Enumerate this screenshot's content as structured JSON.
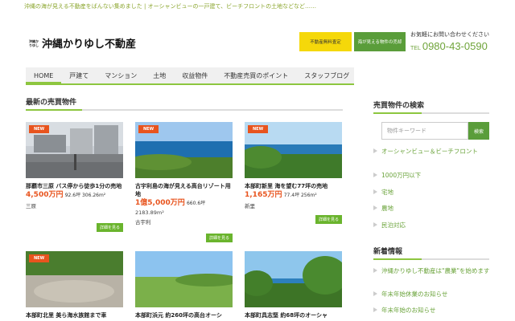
{
  "tagline": "沖縄の海が見える不動産をばんない集めました | オーシャンビューの一戸建て、ビーチフロントの土地などなど……",
  "logo": {
    "mini": "沖縄かりゆし不動産",
    "name": "沖縄かりゆし不動産"
  },
  "header_buttons": [
    "不動産無料査定",
    "海が見える物件の売却"
  ],
  "contact": {
    "label": "お気軽にお問い合わせください",
    "tel_prefix": "TEL",
    "tel": "0980-43-0590"
  },
  "nav": [
    "HOME",
    "戸建て",
    "マンション",
    "土地",
    "収益物件",
    "不動産売買のポイント",
    "スタッフブログ"
  ],
  "section_title": "最新の売買物件",
  "cards": [
    {
      "badge": "NEW",
      "title": "那覇市三原 バス停から徒歩1分の売地",
      "price": "4,500万円",
      "spec": "92.6坪 306.26m²",
      "spec2": "",
      "location": "三原",
      "more": "詳細を見る"
    },
    {
      "badge": "NEW",
      "title": "古宇利島の海が見える高台リゾート用地",
      "price": "1億5,000万円",
      "spec": "660.6坪",
      "spec2": "2183.89m²",
      "location": "古宇利",
      "more": "詳細を見る"
    },
    {
      "badge": "NEW",
      "title": "本部町新里 海を望む77坪の売地",
      "price": "1,165万円",
      "spec": "77.4坪 256m²",
      "spec2": "",
      "location": "新里",
      "more": "詳細を見る"
    },
    {
      "badge": "NEW",
      "title": "本部町北里 美ら海水族館まで車",
      "price": "",
      "spec": "",
      "spec2": "",
      "location": "",
      "more": ""
    },
    {
      "badge": "",
      "title": "本部町浜元 約260坪の高台オーシ",
      "price": "",
      "spec": "",
      "spec2": "",
      "location": "",
      "more": ""
    },
    {
      "badge": "",
      "title": "本部町具志堅 約68坪のオーシャ",
      "price": "",
      "spec": "",
      "spec2": "",
      "location": "",
      "more": ""
    }
  ],
  "sidebar": {
    "search_title": "売買物件の検索",
    "search_placeholder": "物件キーワード",
    "search_button": "検索",
    "categories": [
      "オーシャンビュー＆ビーチフロント",
      "1000万円以下",
      "宅地",
      "農地",
      "民泊対応"
    ],
    "news_title": "新着情報",
    "news": [
      "沖縄かりゆし不動産は\"農業\"を始めます",
      "年末年始休業のお知らせ",
      "年末年始のお知らせ"
    ]
  }
}
